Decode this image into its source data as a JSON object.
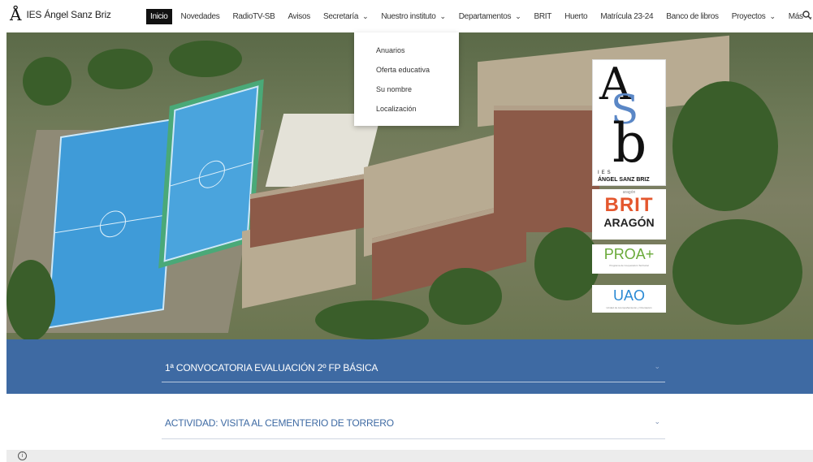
{
  "site": {
    "name": "IES Ángel Sanz Briz",
    "logo_mark": "Å"
  },
  "nav": {
    "items": [
      {
        "label": "Inicio",
        "active": true,
        "dropdown": false
      },
      {
        "label": "Novedades",
        "active": false,
        "dropdown": false
      },
      {
        "label": "RadioTV-SB",
        "active": false,
        "dropdown": false
      },
      {
        "label": "Avisos",
        "active": false,
        "dropdown": false
      },
      {
        "label": "Secretaría",
        "active": false,
        "dropdown": true
      },
      {
        "label": "Nuestro instituto",
        "active": false,
        "dropdown": true
      },
      {
        "label": "Departamentos",
        "active": false,
        "dropdown": true
      },
      {
        "label": "BRIT",
        "active": false,
        "dropdown": false
      },
      {
        "label": "Huerto",
        "active": false,
        "dropdown": false
      },
      {
        "label": "Matrícula 23-24",
        "active": false,
        "dropdown": false
      },
      {
        "label": "Banco de libros",
        "active": false,
        "dropdown": false
      },
      {
        "label": "Proyectos",
        "active": false,
        "dropdown": true
      },
      {
        "label": "Más",
        "active": false,
        "dropdown": true
      }
    ],
    "chevron": "⌄",
    "search_icon": "search-icon"
  },
  "dropdown": {
    "parent": "Nuestro instituto",
    "items": [
      "Anuarios",
      "Oferta educativa",
      "Su nombre",
      "Localización"
    ]
  },
  "logos": {
    "asb": {
      "a": "A",
      "s": "S",
      "b": "b",
      "ies": "IES",
      "name": "ÁNGEL SANZ BRIZ"
    },
    "brit": {
      "top": "aragón",
      "word": "BRIT",
      "region": "ARAGÓN"
    },
    "proa": {
      "word": "PROA+",
      "sub": "Programa de Cooperación Territorial"
    },
    "uao": {
      "word": "UAO",
      "sub": "Unidad de Acompañamiento y Orientación"
    }
  },
  "accordion": [
    {
      "title": "1ª CONVOCATORIA EVALUACIÓN 2º FP BÁSICA",
      "chevron": "⌄"
    },
    {
      "title": "ACTIVIDAD: VISITA AL CEMENTERIO DE TORRERO",
      "chevron": "⌄"
    }
  ],
  "infobar": {
    "icon": "i"
  },
  "colors": {
    "band": "#3e6aa3",
    "active_nav": "#111111"
  }
}
